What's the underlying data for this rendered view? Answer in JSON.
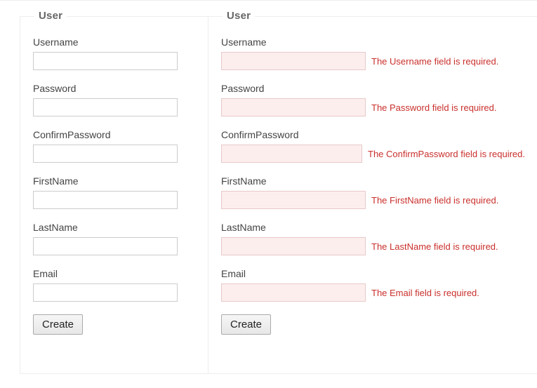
{
  "leftForm": {
    "legend": "User",
    "fields": {
      "username": {
        "label": "Username",
        "value": ""
      },
      "password": {
        "label": "Password",
        "value": ""
      },
      "confirmPassword": {
        "label": "ConfirmPassword",
        "value": ""
      },
      "firstName": {
        "label": "FirstName",
        "value": ""
      },
      "lastName": {
        "label": "LastName",
        "value": ""
      },
      "email": {
        "label": "Email",
        "value": ""
      }
    },
    "submitLabel": "Create"
  },
  "rightForm": {
    "legend": "User",
    "fields": {
      "username": {
        "label": "Username",
        "value": "",
        "error": "The Username field is required."
      },
      "password": {
        "label": "Password",
        "value": "",
        "error": "The Password field is required."
      },
      "confirmPassword": {
        "label": "ConfirmPassword",
        "value": "",
        "error": "The ConfirmPassword field is required."
      },
      "firstName": {
        "label": "FirstName",
        "value": "",
        "error": "The FirstName field is required."
      },
      "lastName": {
        "label": "LastName",
        "value": "",
        "error": "The LastName field is required."
      },
      "email": {
        "label": "Email",
        "value": "",
        "error": "The Email field is required."
      }
    },
    "submitLabel": "Create"
  }
}
